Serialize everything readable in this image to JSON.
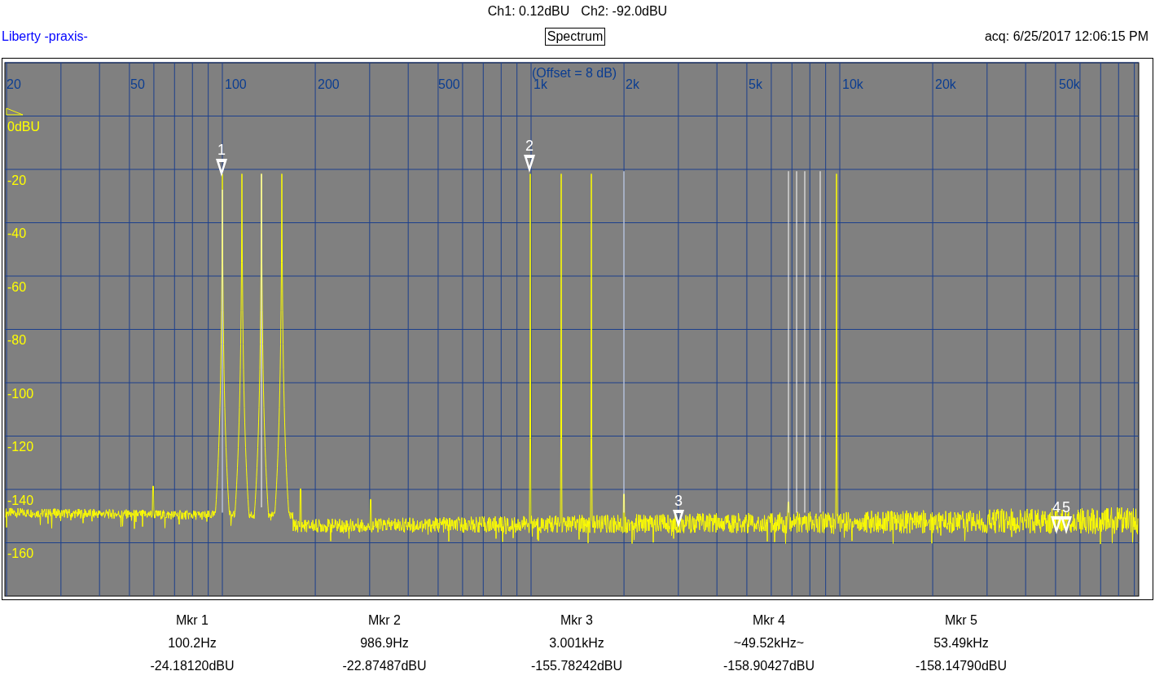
{
  "header": {
    "readouts": [
      "Ch1: 0.12dBU",
      "Ch2: -92.0dBU"
    ],
    "app_name": "Liberty -praxis-",
    "view_title": "Spectrum",
    "acquired": "acq: 6/25/2017 12:06:15 PM"
  },
  "plot": {
    "offset_note": "(Offset = 8 dB)",
    "x_tick_labels": [
      "20",
      "50",
      "100",
      "200",
      "500",
      "1k",
      "2k",
      "5k",
      "10k",
      "20k",
      "50k"
    ],
    "y_tick_labels": [
      "0dBU",
      "-20",
      "-40",
      "-60",
      "-80",
      "-100",
      "-120",
      "-140",
      "-160"
    ],
    "markers": [
      "1",
      "2",
      "3",
      "4",
      "5"
    ]
  },
  "marker_readouts": [
    {
      "label": "Mkr 1",
      "frequency": "100.2Hz",
      "reading": "-24.18120dBU"
    },
    {
      "label": "Mkr 2",
      "frequency": "986.9Hz",
      "reading": "-22.87487dBU"
    },
    {
      "label": "Mkr 3",
      "frequency": "3.001kHz",
      "reading": "-155.78242dBU"
    },
    {
      "label": "Mkr 4",
      "frequency": "~49.52kHz~",
      "reading": "-158.90427dBU"
    },
    {
      "label": "Mkr 5",
      "frequency": "53.49kHz",
      "reading": "-158.14790dBU"
    }
  ]
}
